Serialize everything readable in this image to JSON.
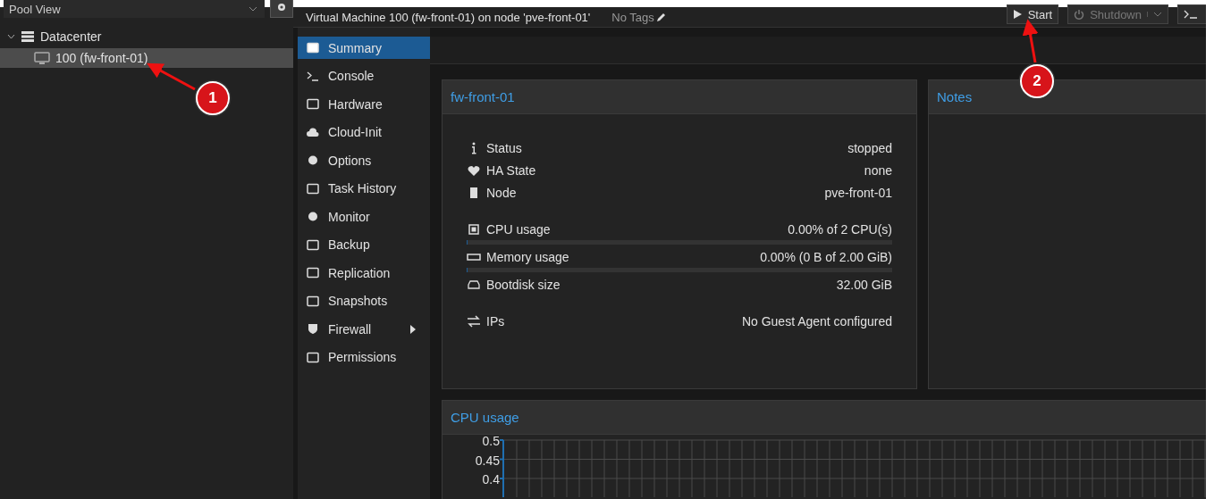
{
  "view_selector": {
    "value": "Pool View"
  },
  "tree": [
    {
      "label": "Datacenter",
      "expanded": true,
      "selected": false,
      "children": [
        {
          "label": "100 (fw-front-01)",
          "selected": true
        }
      ]
    }
  ],
  "header": {
    "title": "Virtual Machine 100 (fw-front-01) on node 'pve-front-01'",
    "tags": "No Tags"
  },
  "toolbar": [
    {
      "label": "Start",
      "disabled": false,
      "menu": false
    },
    {
      "label": "Shutdown",
      "disabled": true,
      "menu": true
    }
  ],
  "nav": [
    {
      "label": "Summary",
      "selected": true,
      "submenu": false
    },
    {
      "label": "Console",
      "selected": false,
      "submenu": false
    },
    {
      "label": "Hardware",
      "selected": false,
      "submenu": false
    },
    {
      "label": "Cloud-Init",
      "selected": false,
      "submenu": false
    },
    {
      "label": "Options",
      "selected": false,
      "submenu": false
    },
    {
      "label": "Task History",
      "selected": false,
      "submenu": false
    },
    {
      "label": "Monitor",
      "selected": false,
      "submenu": false
    },
    {
      "label": "Backup",
      "selected": false,
      "submenu": false
    },
    {
      "label": "Replication",
      "selected": false,
      "submenu": false
    },
    {
      "label": "Snapshots",
      "selected": false,
      "submenu": false
    },
    {
      "label": "Firewall",
      "selected": false,
      "submenu": true
    },
    {
      "label": "Permissions",
      "selected": false,
      "submenu": false
    }
  ],
  "summary": {
    "title": "fw-front-01",
    "rows": [
      {
        "kind": "field",
        "label": "Status",
        "value": "stopped"
      },
      {
        "kind": "field",
        "label": "HA State",
        "value": "none"
      },
      {
        "kind": "field",
        "label": "Node",
        "value": "pve-front-01"
      },
      {
        "kind": "meter",
        "label": "CPU usage",
        "value": "0.00% of 2 CPU(s)",
        "level": 0
      },
      {
        "kind": "meter",
        "label": "Memory usage",
        "value": "0.00% (0 B of 2.00 GiB)",
        "level": 0
      },
      {
        "kind": "field",
        "label": "Bootdisk size",
        "value": "32.00 GiB"
      },
      {
        "kind": "field",
        "label": "IPs",
        "value": "No Guest Agent configured"
      }
    ]
  },
  "notes": {
    "title": "Notes"
  },
  "cpu_panel": {
    "title": "CPU usage",
    "y_ticks": [
      "0.5",
      "0.45",
      "0.4"
    ]
  },
  "annotations": [
    {
      "number": "1"
    },
    {
      "number": "2"
    }
  ]
}
